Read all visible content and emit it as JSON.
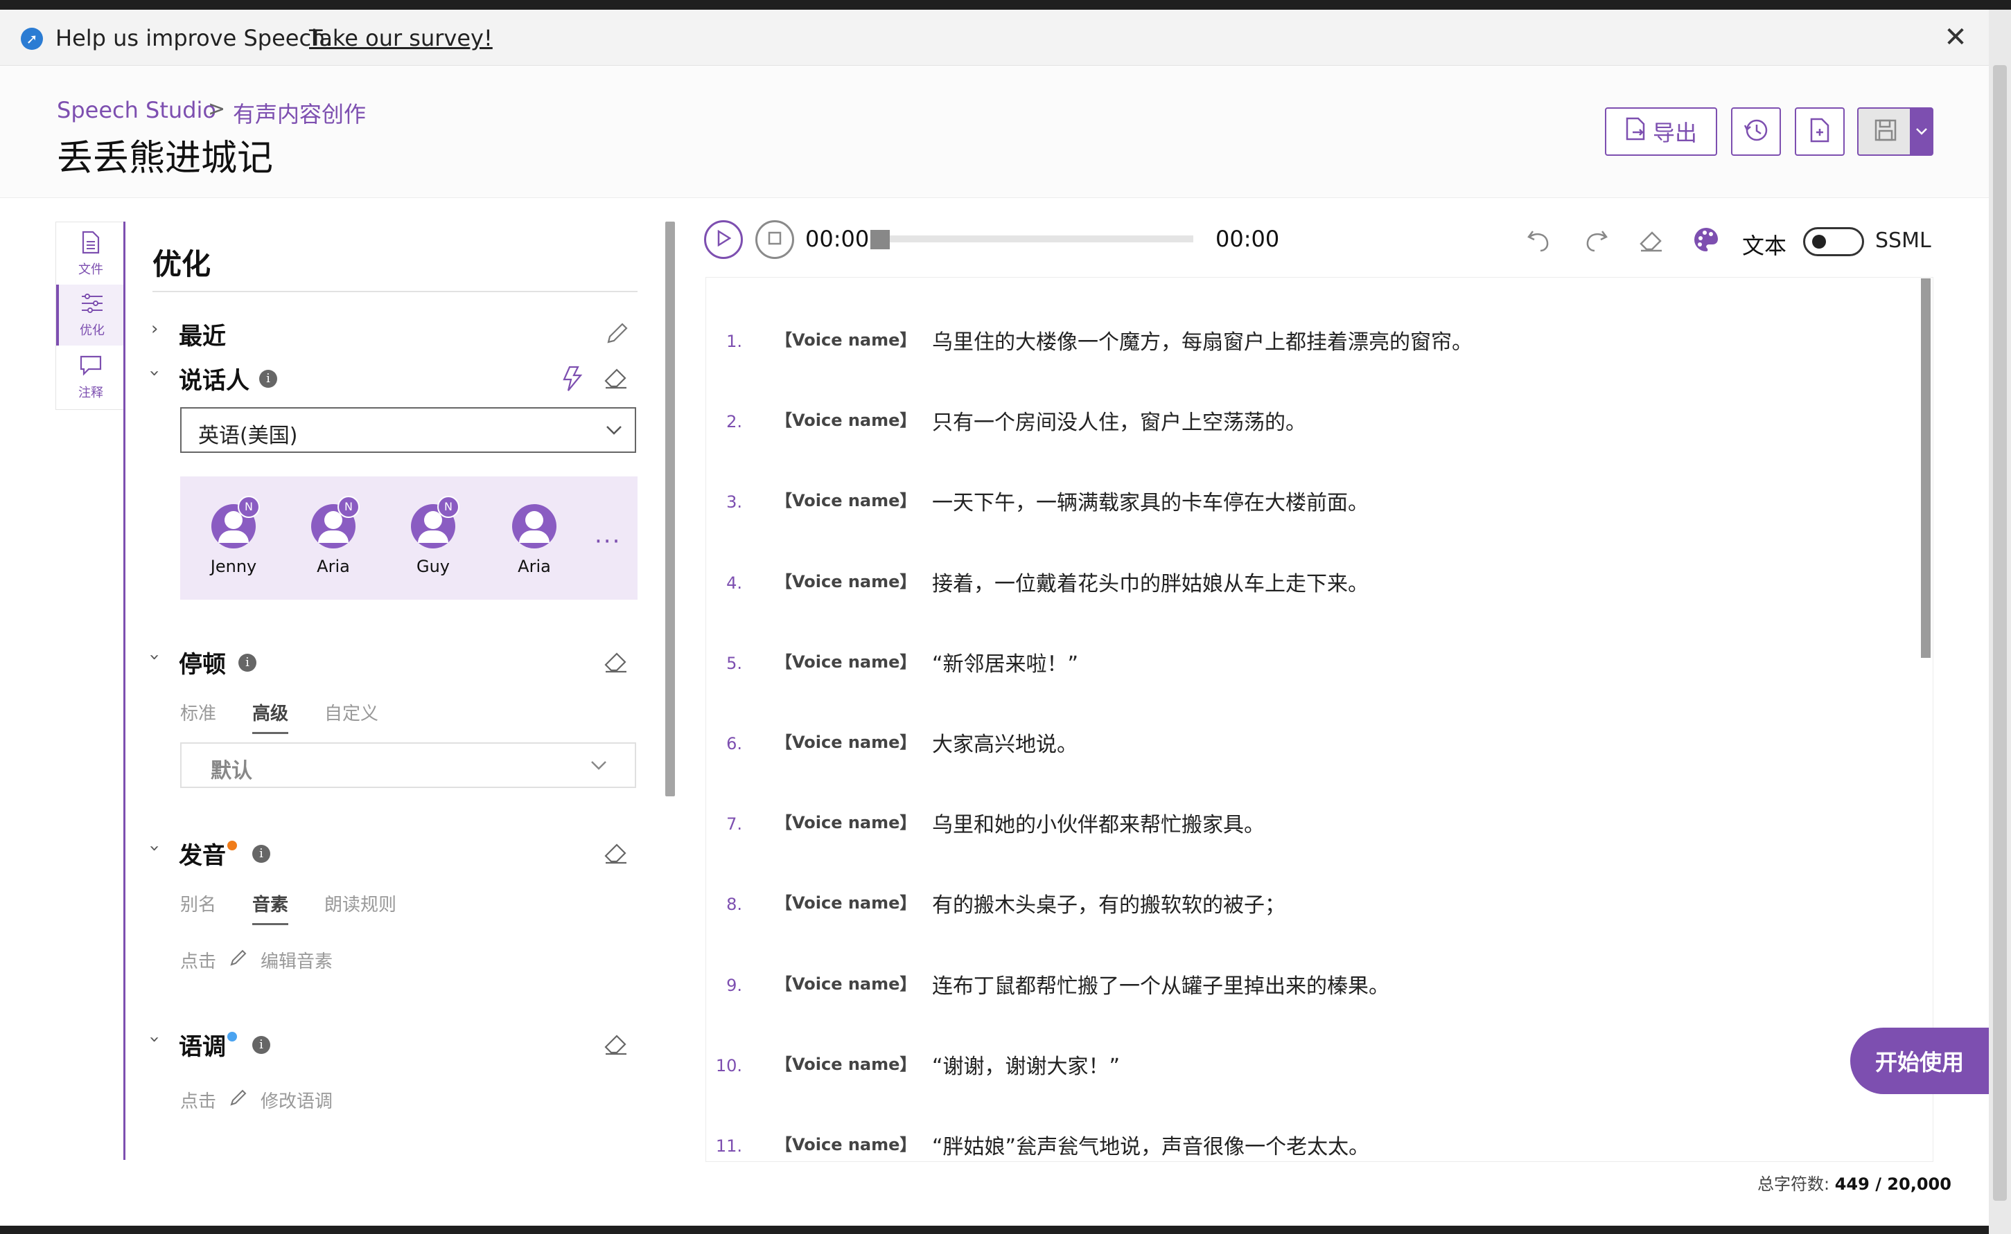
{
  "banner": {
    "message": "Help us improve Speech.",
    "link": "Take our survey!",
    "close_glyph": "✕"
  },
  "header": {
    "breadcrumb_root": "Speech Studio",
    "breadcrumb_sep": ">",
    "breadcrumb_current": "有声内容创作",
    "title": "丢丢熊进城记",
    "export_label": "导出"
  },
  "leftnav": {
    "items": [
      {
        "label": "文件",
        "icon": "document-icon"
      },
      {
        "label": "优化",
        "icon": "sliders-icon"
      },
      {
        "label": "注释",
        "icon": "comment-icon"
      }
    ]
  },
  "panel": {
    "title": "优化",
    "recent": {
      "title": "最近"
    },
    "speaker": {
      "title": "说话人",
      "language": "英语(美国)",
      "voices": [
        {
          "name": "Jenny",
          "badge": "N"
        },
        {
          "name": "Aria",
          "badge": "N"
        },
        {
          "name": "Guy",
          "badge": "N"
        },
        {
          "name": "Aria",
          "badge": ""
        }
      ],
      "more": "···"
    },
    "pause": {
      "title": "停顿",
      "tabs": [
        "标准",
        "高级",
        "自定义"
      ],
      "active_tab": "高级",
      "select_value": "默认"
    },
    "pronunciation": {
      "title": "发音",
      "tabs": [
        "别名",
        "音素",
        "朗读规则"
      ],
      "active_tab": "音素",
      "hint_prefix": "点击",
      "hint_action": "编辑音素"
    },
    "intonation": {
      "title": "语调",
      "hint_prefix": "点击",
      "hint_action": "修改语调"
    }
  },
  "player": {
    "current_time": "00:00",
    "total_time": "00:00",
    "progress": 0
  },
  "modes": {
    "text": "文本",
    "ssml": "SSML",
    "ssml_enabled": false
  },
  "editor": {
    "voice_tag": "【Voice name】",
    "lines": [
      {
        "num": "1.",
        "text": "乌里住的大楼像一个魔方，每扇窗户上都挂着漂亮的窗帘。"
      },
      {
        "num": "2.",
        "text": "只有一个房间没人住，窗户上空荡荡的。"
      },
      {
        "num": "3.",
        "text": "一天下午，一辆满载家具的卡车停在大楼前面。"
      },
      {
        "num": "4.",
        "text": "接着，一位戴着花头巾的胖姑娘从车上走下来。"
      },
      {
        "num": "5.",
        "text": "“新邻居来啦！”"
      },
      {
        "num": "6.",
        "text": "大家高兴地说。"
      },
      {
        "num": "7.",
        "text": "乌里和她的小伙伴都来帮忙搬家具。"
      },
      {
        "num": "8.",
        "text": "有的搬木头桌子，有的搬软软的被子；"
      },
      {
        "num": "9.",
        "text": "连布丁鼠都帮忙搬了一个从罐子里掉出来的榛果。"
      },
      {
        "num": "10.",
        "text": "“谢谢，谢谢大家！”"
      },
      {
        "num": "11.",
        "text": "“胖姑娘”瓮声瓮气地说，声音很像一个老太太。"
      }
    ]
  },
  "cta": {
    "label": "开始使用"
  },
  "footer": {
    "count_label": "总字符数:",
    "count_value": "449 / 20,000"
  },
  "colors": {
    "accent": "#7d4fb0",
    "orange_dot": "#f07c1a",
    "blue_dot": "#4aa3f0"
  }
}
